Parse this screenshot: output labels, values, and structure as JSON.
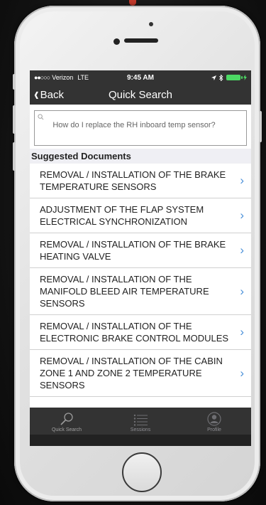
{
  "status_bar": {
    "carrier": "Verizon",
    "network": "LTE",
    "time": "9:45 AM"
  },
  "nav": {
    "back_label": "Back",
    "title": "Quick Search"
  },
  "search": {
    "query": "How do I replace the RH inboard temp sensor?"
  },
  "section_header": "Suggested Documents",
  "documents": [
    {
      "title": "REMOVAL / INSTALLATION OF THE BRAKE TEMPERATURE SENSORS"
    },
    {
      "title": "ADJUSTMENT OF THE FLAP SYSTEM ELECTRICAL SYNCHRONIZATION"
    },
    {
      "title": "REMOVAL / INSTALLATION OF THE BRAKE HEATING VALVE"
    },
    {
      "title": "REMOVAL / INSTALLATION OF THE MANIFOLD BLEED AIR TEMPERATURE SENSORS"
    },
    {
      "title": "REMOVAL / INSTALLATION OF THE ELECTRONIC BRAKE CONTROL MODULES"
    },
    {
      "title": "REMOVAL / INSTALLATION OF THE CABIN ZONE 1 AND ZONE 2 TEMPERATURE SENSORS"
    }
  ],
  "tabs": [
    {
      "label": "Quick Search",
      "icon": "search-icon",
      "active": true
    },
    {
      "label": "Sessions",
      "icon": "list-icon",
      "active": false
    },
    {
      "label": "Profile",
      "icon": "profile-icon",
      "active": false
    }
  ],
  "colors": {
    "chevron": "#4a90d9",
    "bar_background": "#333333",
    "battery": "#4cd964"
  }
}
